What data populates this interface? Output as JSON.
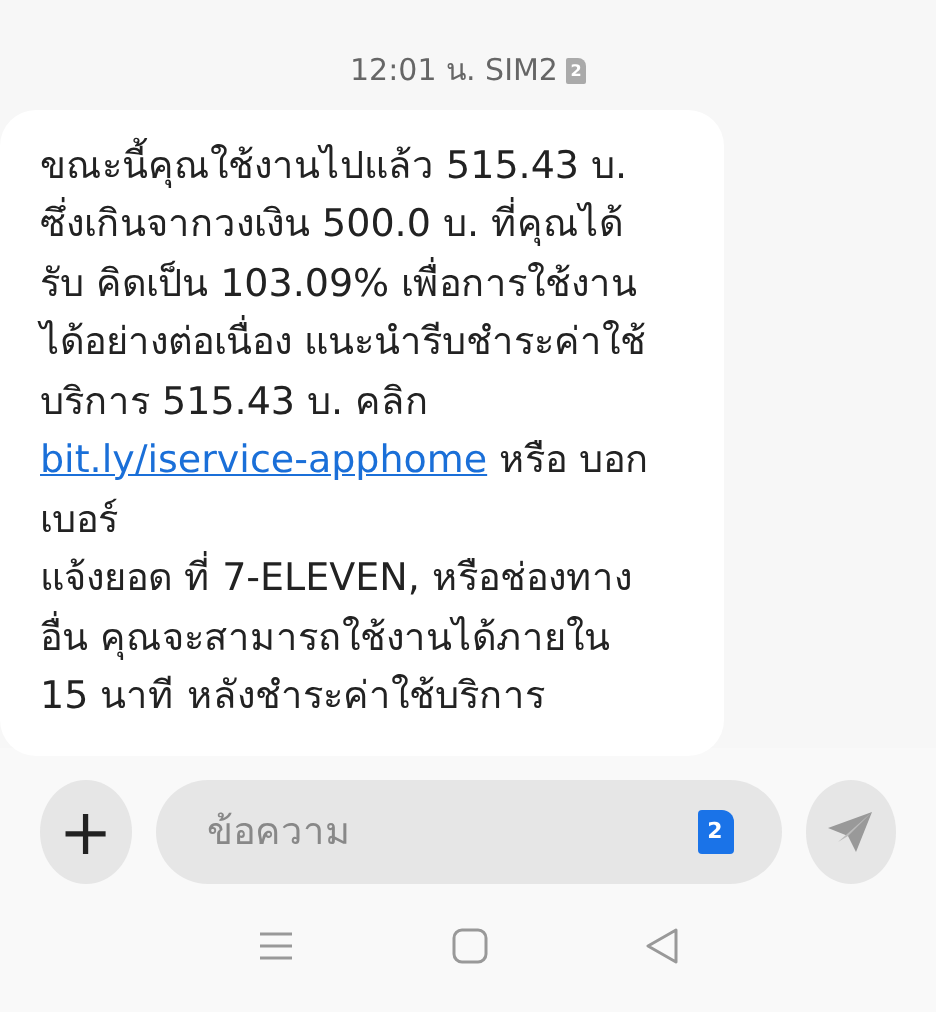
{
  "timestamp": {
    "time": "12:01 น. SIM2",
    "sim_badge": "2"
  },
  "message": {
    "text_before_link": "ขณะนี้คุณใช้งานไปแล้ว 515.43 บ.\nซึ่งเกินจากวงเงิน 500.0 บ. ที่คุณได้\nรับ คิดเป็น 103.09% เพื่อการใช้งาน\nได้อย่างต่อเนื่อง แนะนำรีบชำระค่าใช้\nบริการ 515.43 บ. คลิก ",
    "link": "bit.ly/iservice-apphome",
    "text_after_link": " หรือ บอกเบอร์\nแจ้งยอด ที่ 7-ELEVEN, หรือช่องทาง\nอื่น คุณจะสามารถใช้งานได้ภายใน\n15 นาที หลังชำระค่าใช้บริการ"
  },
  "composer": {
    "add_button": "+",
    "placeholder": "ข้อความ",
    "sim_badge": "2"
  }
}
